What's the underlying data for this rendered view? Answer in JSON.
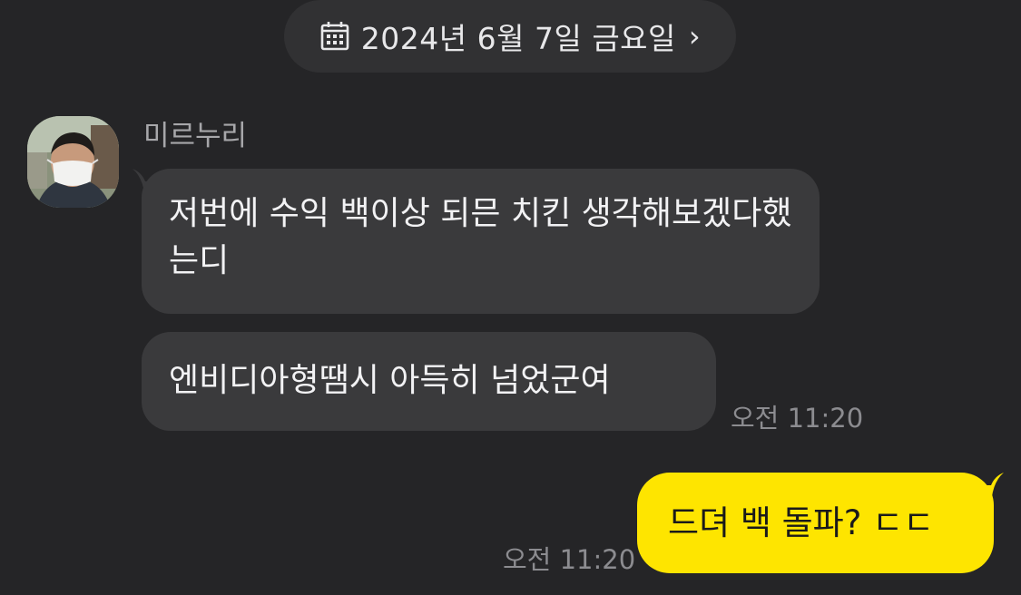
{
  "date_header": {
    "text": "2024년 6월 7일 금요일",
    "chevron": "›",
    "icon": "calendar-icon"
  },
  "incoming": {
    "sender": "미르누리",
    "avatar_icon": "profile-photo",
    "messages": [
      {
        "text": "저번에 수익 백이상 되믄 치킨 생각해보겠다했는디"
      },
      {
        "text": "엔비디아형땜시 아득히 넘었군여"
      }
    ],
    "time": "오전 11:20"
  },
  "outgoing": {
    "messages": [
      {
        "text": "드뎌 백 돌파? ㄷㄷ"
      }
    ],
    "time": "오전 11:20"
  },
  "colors": {
    "background": "#252527",
    "incoming_bubble": "#3a3a3c",
    "outgoing_bubble": "#fee500"
  }
}
